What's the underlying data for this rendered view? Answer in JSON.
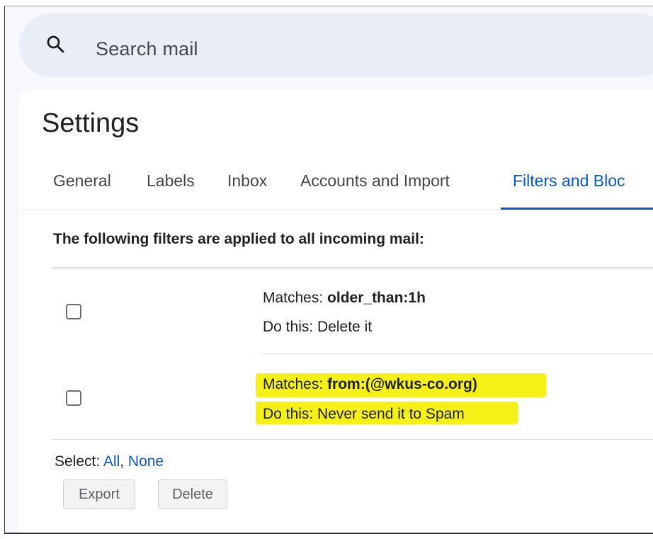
{
  "search": {
    "placeholder": "Search mail",
    "icon": "search-icon"
  },
  "settings": {
    "title": "Settings"
  },
  "tabs": [
    {
      "label": "General",
      "active": false
    },
    {
      "label": "Labels",
      "active": false
    },
    {
      "label": "Inbox",
      "active": false
    },
    {
      "label": "Accounts and Import",
      "active": false
    },
    {
      "label": "Filters and Bloc",
      "active": true
    }
  ],
  "filters": {
    "heading": "The following filters are applied to all incoming mail:",
    "items": [
      {
        "matches_label": "Matches: ",
        "matches_value": "older_than:1h",
        "action": "Do this: Delete it",
        "checked": false,
        "highlighted": false
      },
      {
        "matches_label": "Matches: ",
        "matches_value": "from:(@wkus-co.org)",
        "action": "Do this: Never send it to Spam",
        "checked": false,
        "highlighted": true
      }
    ]
  },
  "selection": {
    "label": "Select: ",
    "all": "All",
    "separator": ", ",
    "none": "None"
  },
  "buttons": {
    "export": "Export",
    "delete": "Delete"
  },
  "colors": {
    "accent": "#0b57d0",
    "highlight": "#f4f00b",
    "search_bg": "#e9eef6"
  }
}
